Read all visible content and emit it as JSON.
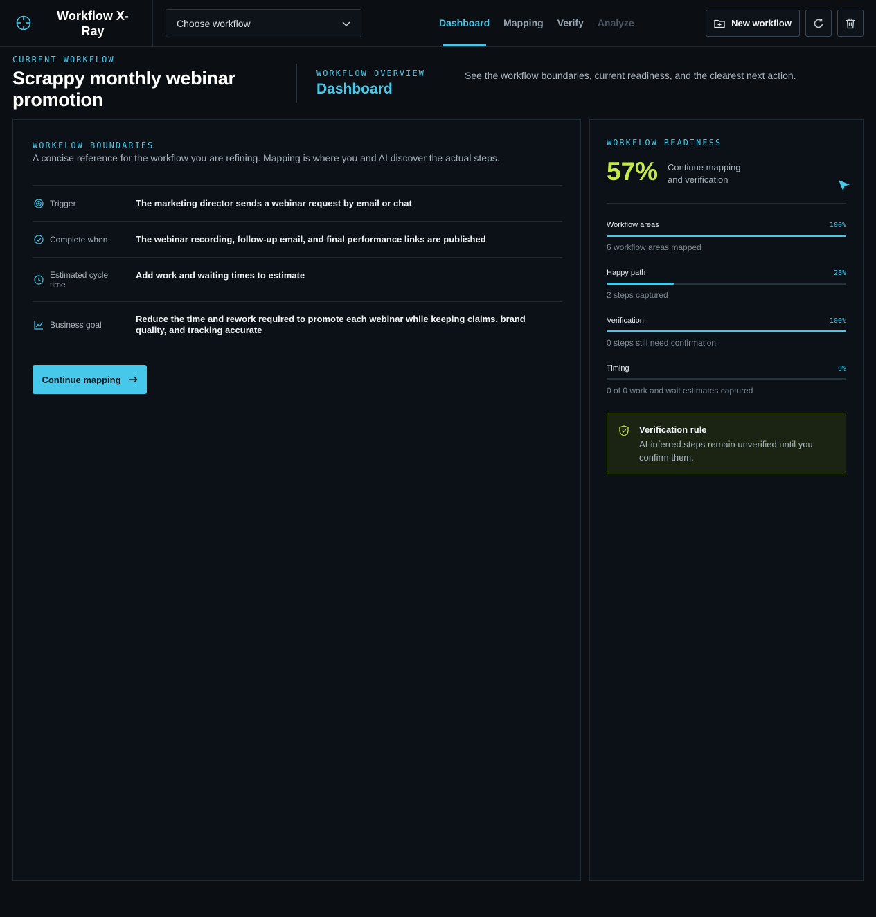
{
  "app": {
    "title": "Workflow X-Ray"
  },
  "toolbar": {
    "workflow_select": "Choose workflow",
    "new_workflow_label": "New workflow"
  },
  "nav": {
    "tabs": [
      {
        "label": "Dashboard",
        "state": "active"
      },
      {
        "label": "Mapping",
        "state": "normal"
      },
      {
        "label": "Verify",
        "state": "normal"
      },
      {
        "label": "Analyze",
        "state": "disabled"
      }
    ]
  },
  "header": {
    "current_eyebrow": "CURRENT WORKFLOW",
    "current_title": "Scrappy monthly webinar promotion",
    "overview_eyebrow": "WORKFLOW OVERVIEW",
    "overview_title": "Dashboard",
    "overview_desc": "See the workflow boundaries, current readiness, and the clearest next action."
  },
  "boundaries": {
    "eyebrow": "WORKFLOW BOUNDARIES",
    "description": "A concise reference for the workflow you are refining. Mapping is where you and AI discover the actual steps.",
    "rows": [
      {
        "icon": "target-icon",
        "label": "Trigger",
        "value": "The marketing director sends a webinar request by email or chat"
      },
      {
        "icon": "check-circle-icon",
        "label": "Complete when",
        "value": "The webinar recording, follow-up email, and final performance links are published"
      },
      {
        "icon": "clock-icon",
        "label": "Estimated cycle time",
        "value": "Add work and waiting times to estimate"
      },
      {
        "icon": "trend-chart-icon",
        "label": "Business goal",
        "value": "Reduce the time and rework required to promote each webinar while keeping claims, brand quality, and tracking accurate"
      }
    ],
    "continue_label": "Continue mapping"
  },
  "readiness": {
    "eyebrow": "WORKFLOW READINESS",
    "percent": "57%",
    "label": "Continue mapping and verification",
    "metrics": [
      {
        "name": "Workflow areas",
        "percent_text": "100%",
        "fraction": 1.0,
        "sub": "6 workflow areas mapped"
      },
      {
        "name": "Happy path",
        "percent_text": "28%",
        "fraction": 0.28,
        "sub": "2 steps captured"
      },
      {
        "name": "Verification",
        "percent_text": "100%",
        "fraction": 1.0,
        "sub": "0 steps still need confirmation"
      },
      {
        "name": "Timing",
        "percent_text": "0%",
        "fraction": 0.0,
        "sub": "0 of 0 work and wait estimates captured"
      }
    ],
    "rule_title": "Verification rule",
    "rule_text": "AI-inferred steps remain unverified until you confirm them."
  },
  "colors": {
    "accent": "#45c8ea",
    "readiness": "#c5e84d",
    "background": "#0b0f14"
  }
}
